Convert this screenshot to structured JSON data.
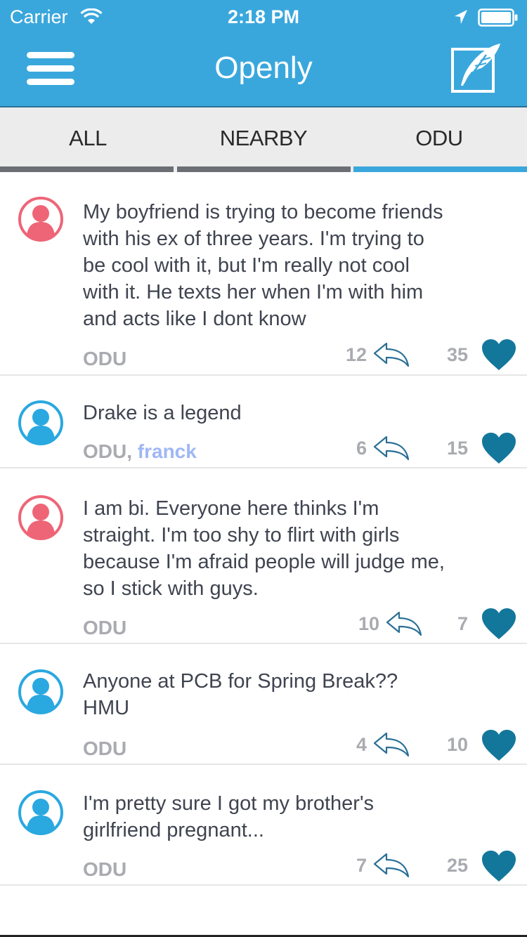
{
  "status_bar": {
    "carrier": "Carrier",
    "time": "2:18 PM",
    "icons": [
      "wifi-icon",
      "location-arrow-icon",
      "battery-icon"
    ]
  },
  "header": {
    "title": "Openly",
    "menu_icon": "hamburger-menu-icon",
    "compose_icon": "compose-feather-icon",
    "bar_color": "#3aa7dc"
  },
  "tabs": [
    {
      "label": "ALL",
      "active": false
    },
    {
      "label": "NEARBY",
      "active": false
    },
    {
      "label": "ODU",
      "active": true
    }
  ],
  "colors": {
    "accent": "#3aa7dc",
    "female_avatar": "#ee6577",
    "male_avatar": "#2aa8e0",
    "heart": "#13779b",
    "author": "#9fb7f5"
  },
  "posts": [
    {
      "avatar": "female",
      "text_lines": [
        "My boyfriend is trying to become friends",
        "with his ex of three years. I'm trying to",
        "be cool with it, but I'm really not cool",
        "with it. He texts her when I'm with him",
        "and acts like I dont know"
      ],
      "location": "ODU",
      "author": "",
      "replies": "12",
      "likes": "35"
    },
    {
      "avatar": "male",
      "text_lines": [
        "Drake is a legend"
      ],
      "location": "ODU,",
      "author": "franck",
      "replies": "6",
      "likes": "15"
    },
    {
      "avatar": "female",
      "text_lines": [
        "I am bi. Everyone here thinks I'm",
        "straight. I'm too shy to flirt with girls",
        "because I'm afraid people will judge me,",
        "so I stick with guys."
      ],
      "location": "ODU",
      "author": "",
      "replies": "10",
      "likes": "7"
    },
    {
      "avatar": "male",
      "text_lines": [
        "Anyone at PCB for Spring Break??",
        "HMU"
      ],
      "location": "ODU",
      "author": "",
      "replies": "4",
      "likes": "10"
    },
    {
      "avatar": "male",
      "text_lines": [
        "I'm pretty sure I got my brother's",
        "girlfriend pregnant..."
      ],
      "location": "ODU",
      "author": "",
      "replies": "7",
      "likes": "25"
    }
  ]
}
